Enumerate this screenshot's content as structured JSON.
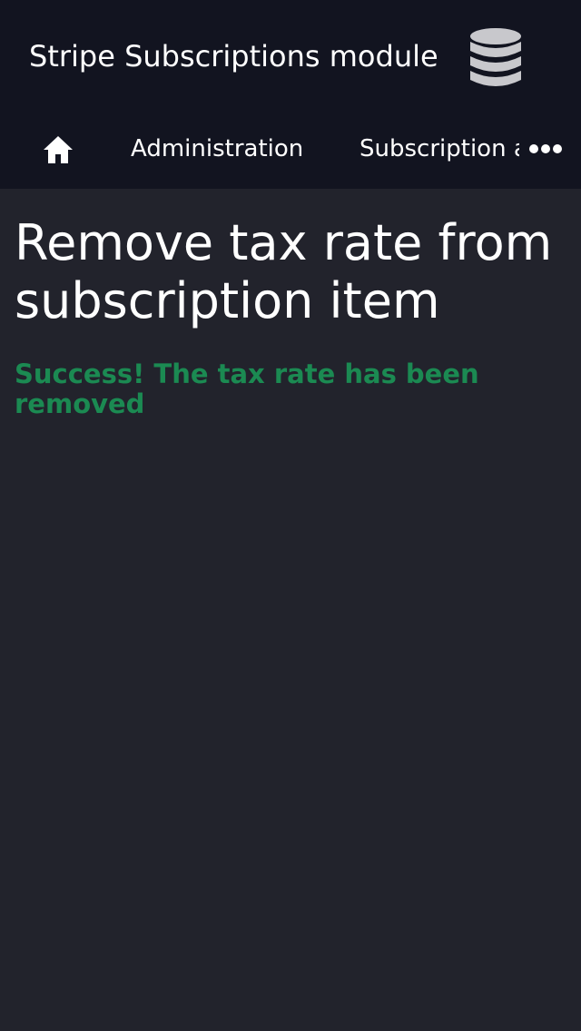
{
  "header": {
    "app_title": "Stripe Subscriptions module",
    "icon": "database-icon"
  },
  "nav": {
    "home_icon": "home-icon",
    "items": [
      {
        "label": "Administration"
      },
      {
        "label": "Subscription a"
      }
    ],
    "more_icon": "more-dots-icon"
  },
  "main": {
    "title": "Remove tax rate from subscription item",
    "success_message": "Success! The tax rate has been removed"
  },
  "colors": {
    "header_bg": "#121420",
    "page_bg": "#22232c",
    "success": "#1b8a52",
    "icon": "#c8c8cc"
  }
}
